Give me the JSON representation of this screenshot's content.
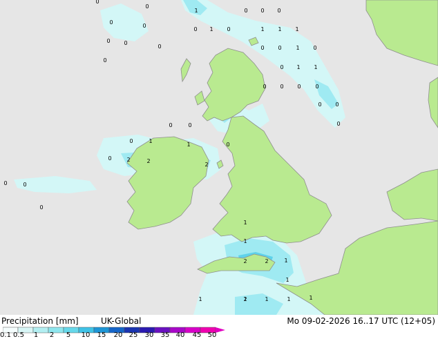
{
  "map": {
    "colors": {
      "sea": "#e6e6e6",
      "land": "#b9ea90",
      "coast": "#8e8e8e",
      "precip_light": "#d3f7f7",
      "precip_mid": "#9feaf2",
      "precip_heavy": "#5fd2ea"
    },
    "precip_labels": [
      "0",
      "0",
      "0",
      "0",
      "0",
      "0",
      "0",
      "0",
      "0",
      "0",
      "0",
      "0",
      "0",
      "0",
      "0",
      "0",
      "1",
      "1",
      "1",
      "1",
      "1",
      "1",
      "1",
      "1",
      "1",
      "1",
      "1",
      "1",
      "1",
      "1",
      "1",
      "1",
      "0",
      "0",
      "0",
      "0",
      "0",
      "0",
      "0",
      "0",
      "0",
      "0",
      "0",
      "0",
      "0",
      "0",
      "0",
      "0",
      "2",
      "2",
      "2",
      "2",
      "2",
      "2",
      "1",
      "1",
      "1",
      "1",
      "1"
    ]
  },
  "footer": {
    "title": "Precipitation [mm]",
    "model": "UK-Global",
    "valid_time": "Mo 09-02-2026 16..17 UTC (12+05)"
  },
  "legend": {
    "ticks": [
      "0.1",
      "0.5",
      "1",
      "2",
      "5",
      "10",
      "15",
      "20",
      "25",
      "30",
      "35",
      "40",
      "45",
      "50"
    ],
    "colors": [
      "#f5fdfd",
      "#d8f6f6",
      "#b3eff2",
      "#8ee6ee",
      "#66d8ea",
      "#3fc2e6",
      "#1e96d6",
      "#1565c8",
      "#1a34b0",
      "#2a1ab0",
      "#6a10c0",
      "#a808c8",
      "#d800c8",
      "#f000b0"
    ]
  }
}
